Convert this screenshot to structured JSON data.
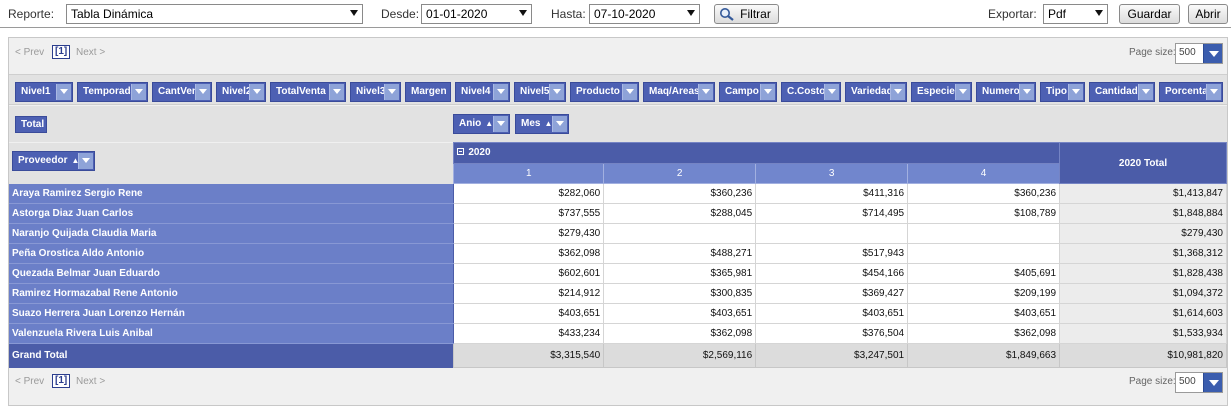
{
  "toolbar": {
    "reporte_label": "Reporte:",
    "reporte_value": "Tabla Dinámica",
    "desde_label": "Desde:",
    "desde_value": "01-01-2020",
    "hasta_label": "Hasta:",
    "hasta_value": "07-10-2020",
    "filtrar_label": "Filtrar",
    "exportar_label": "Exportar:",
    "exportar_value": "Pdf",
    "guardar_label": "Guardar",
    "abrir_label": "Abrir"
  },
  "pager": {
    "prev": "< Prev",
    "page": "[1]",
    "next": "Next >",
    "page_size_label": "Page size:",
    "page_size": "500"
  },
  "filter_fields": [
    {
      "label": "Nivel1",
      "dropdown": true
    },
    {
      "label": "Temporada",
      "dropdown": true
    },
    {
      "label": "CantVen",
      "dropdown": true
    },
    {
      "label": "Nivel2",
      "dropdown": true
    },
    {
      "label": "TotalVenta",
      "dropdown": true
    },
    {
      "label": "Nivel3",
      "dropdown": true
    },
    {
      "label": "Margen",
      "dropdown": false
    },
    {
      "label": "Nivel4",
      "dropdown": true
    },
    {
      "label": "Nivel5",
      "dropdown": true
    },
    {
      "label": "Producto",
      "dropdown": true
    },
    {
      "label": "Maq/Areas",
      "dropdown": true
    },
    {
      "label": "Campo",
      "dropdown": true
    },
    {
      "label": "C.Costo",
      "dropdown": true
    },
    {
      "label": "Variedad",
      "dropdown": true
    },
    {
      "label": "Especie",
      "dropdown": true
    },
    {
      "label": "Numero",
      "dropdown": true
    },
    {
      "label": "Tipo",
      "dropdown": true
    },
    {
      "label": "Cantidad",
      "dropdown": true
    },
    {
      "label": "Porcentaje",
      "dropdown": true
    }
  ],
  "data_field": "Total",
  "column_fields": [
    {
      "label": "Anio",
      "sort": "▲"
    },
    {
      "label": "Mes",
      "sort": "▲"
    }
  ],
  "row_field": {
    "label": "Proveedor",
    "sort": "▲"
  },
  "year": "2020",
  "months": [
    "1",
    "2",
    "3",
    "4"
  ],
  "year_total_label": "2020 Total",
  "rows": [
    {
      "name": "Araya Ramirez Sergio Rene",
      "values": [
        "$282,060",
        "$360,236",
        "$411,316",
        "$360,236"
      ],
      "total": "$1,413,847"
    },
    {
      "name": "Astorga Diaz Juan Carlos",
      "values": [
        "$737,555",
        "$288,045",
        "$714,495",
        "$108,789"
      ],
      "total": "$1,848,884"
    },
    {
      "name": "Naranjo Quijada Claudia Maria",
      "values": [
        "$279,430",
        "",
        "",
        ""
      ],
      "total": "$279,430"
    },
    {
      "name": "Peña Orostica Aldo Antonio",
      "values": [
        "$362,098",
        "$488,271",
        "$517,943",
        ""
      ],
      "total": "$1,368,312"
    },
    {
      "name": "Quezada Belmar Juan Eduardo",
      "values": [
        "$602,601",
        "$365,981",
        "$454,166",
        "$405,691"
      ],
      "total": "$1,828,438"
    },
    {
      "name": "Ramirez Hormazabal Rene Antonio",
      "values": [
        "$214,912",
        "$300,835",
        "$369,427",
        "$209,199"
      ],
      "total": "$1,094,372"
    },
    {
      "name": "Suazo Herrera Juan Lorenzo Hernán",
      "values": [
        "$403,651",
        "$403,651",
        "$403,651",
        "$403,651"
      ],
      "total": "$1,614,603"
    },
    {
      "name": "Valenzuela Rivera Luis Anibal",
      "values": [
        "$433,234",
        "$362,098",
        "$376,504",
        "$362,098"
      ],
      "total": "$1,533,934"
    }
  ],
  "grand_total": {
    "label": "Grand Total",
    "values": [
      "$3,315,540",
      "$2,569,116",
      "$3,247,501",
      "$1,849,663"
    ],
    "total": "$10,981,820"
  }
}
